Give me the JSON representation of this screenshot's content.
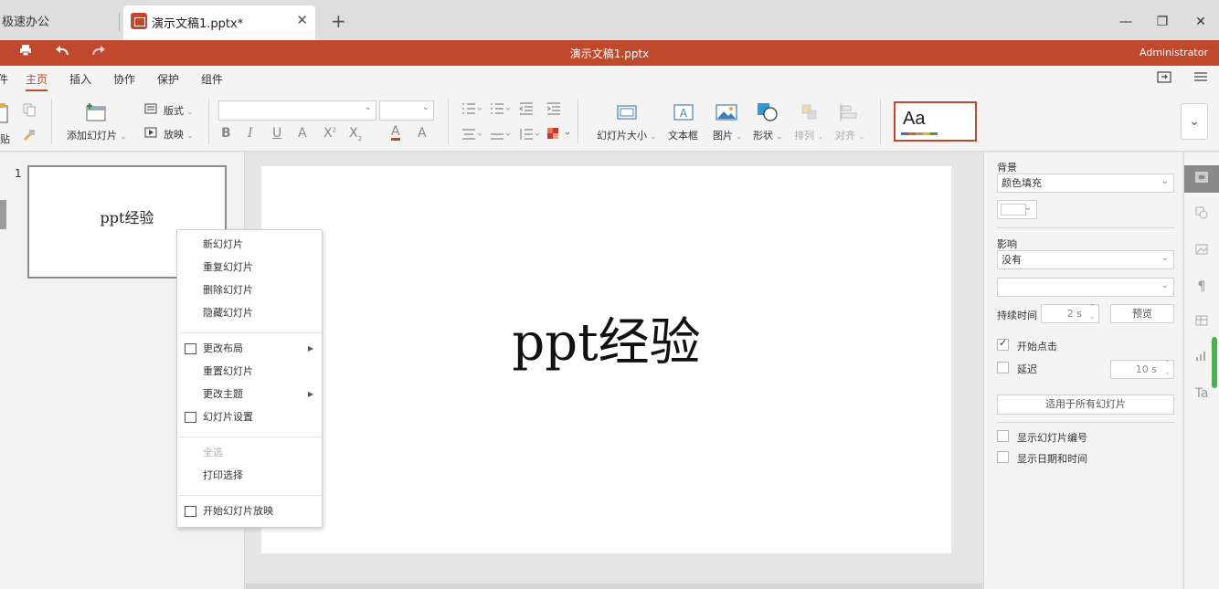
{
  "tabs": {
    "home": "极速办公",
    "active_title": "演示文稿1.pptx*",
    "close": "✕",
    "add": "+"
  },
  "window_controls": {
    "minimize": "—",
    "restore": "❐",
    "close": "✕"
  },
  "appbar": {
    "title": "演示文稿1.pptx",
    "user": "Administrator",
    "print_icon": "print-icon",
    "undo_icon": "undo-icon",
    "redo_icon": "redo-icon",
    "brand_color": "#c0492d"
  },
  "menu": {
    "cut_prefix": "件",
    "items": [
      "主页",
      "插入",
      "协作",
      "保护",
      "组件"
    ],
    "active": "主页"
  },
  "ribbon": {
    "paste_label": "贴",
    "add_slide": "添加幻灯片",
    "layout": "版式",
    "play": "放映",
    "slide_size": "幻灯片大小",
    "textbox": "文本框",
    "picture": "图片",
    "shape": "形状",
    "arrange": "排列",
    "align": "对齐",
    "theme_sample": "Aa",
    "theme_colors": [
      "#3c6fb6",
      "#e0641e",
      "#9a9a9a",
      "#f2b400",
      "#4a9a44"
    ]
  },
  "thumbnails": [
    {
      "number": "1",
      "text": "ppt经验"
    }
  ],
  "slide": {
    "text": "ppt经验"
  },
  "context_menu": {
    "new_slide": "新幻灯片",
    "duplicate_slide": "重复幻灯片",
    "delete_slide": "删除幻灯片",
    "hide_slide": "隐藏幻灯片",
    "change_layout": "更改布局",
    "reset_slide": "重置幻灯片",
    "change_theme": "更改主题",
    "slide_settings": "幻灯片设置",
    "select_all": "全选",
    "print_selection": "打印选择",
    "start_show": "开始幻灯片放映"
  },
  "properties": {
    "background_label": "背景",
    "background_fill": "颜色填充",
    "transition_label": "影响",
    "transition_value": "没有",
    "duration_label": "持续时间",
    "duration_value": "2 s",
    "preview": "预览",
    "on_click_label": "开始点击",
    "on_click_checked": true,
    "delay_label": "延迟",
    "delay_checked": false,
    "delay_value": "10 s",
    "apply_all": "适用于所有幻灯片",
    "show_slide_number": "显示幻灯片编号",
    "show_date_time": "显示日期和时间"
  }
}
